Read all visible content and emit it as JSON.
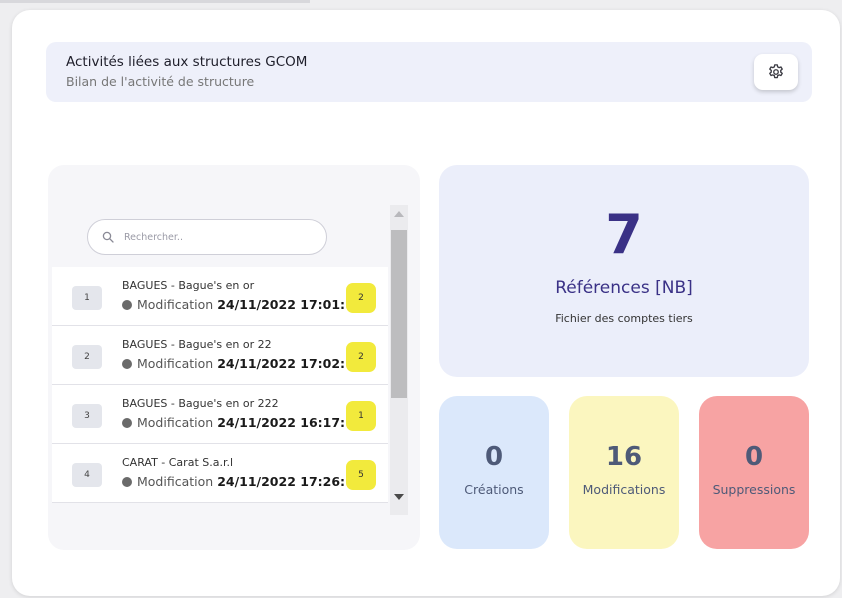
{
  "header": {
    "title": "Activités liées aux structures GCOM",
    "subtitle": "Bilan de l'activité de structure",
    "settings_icon": "gear-icon"
  },
  "search": {
    "placeholder": "Rechercher..",
    "icon": "search-icon"
  },
  "list": {
    "items": [
      {
        "index": "1",
        "title": "BAGUES - Bague's en or",
        "action": "Modification",
        "date": "24/11/2022 17:01:",
        "count": "2"
      },
      {
        "index": "2",
        "title": "BAGUES - Bague's en or 22",
        "action": "Modification",
        "date": "24/11/2022 17:02:",
        "count": "2"
      },
      {
        "index": "3",
        "title": "BAGUES - Bague's en or 222",
        "action": "Modification",
        "date": "24/11/2022 16:17:",
        "count": "1"
      },
      {
        "index": "4",
        "title": "CARAT - Carat S.a.r.l",
        "action": "Modification",
        "date": "24/11/2022 17:26:",
        "count": "5"
      }
    ]
  },
  "kpi": {
    "value": "7",
    "label": "Références [NB]",
    "sub": "Fichier des comptes tiers"
  },
  "stats": {
    "creations": {
      "value": "0",
      "label": "Créations",
      "color": "#dbe8fb"
    },
    "modifications": {
      "value": "16",
      "label": "Modifications",
      "color": "#fbf6bf"
    },
    "suppressions": {
      "value": "0",
      "label": "Suppressions",
      "color": "#f7a3a3"
    }
  },
  "colors": {
    "accent": "#3a3186",
    "badge": "#f2ea3c",
    "stat_text": "#4e5a78"
  }
}
